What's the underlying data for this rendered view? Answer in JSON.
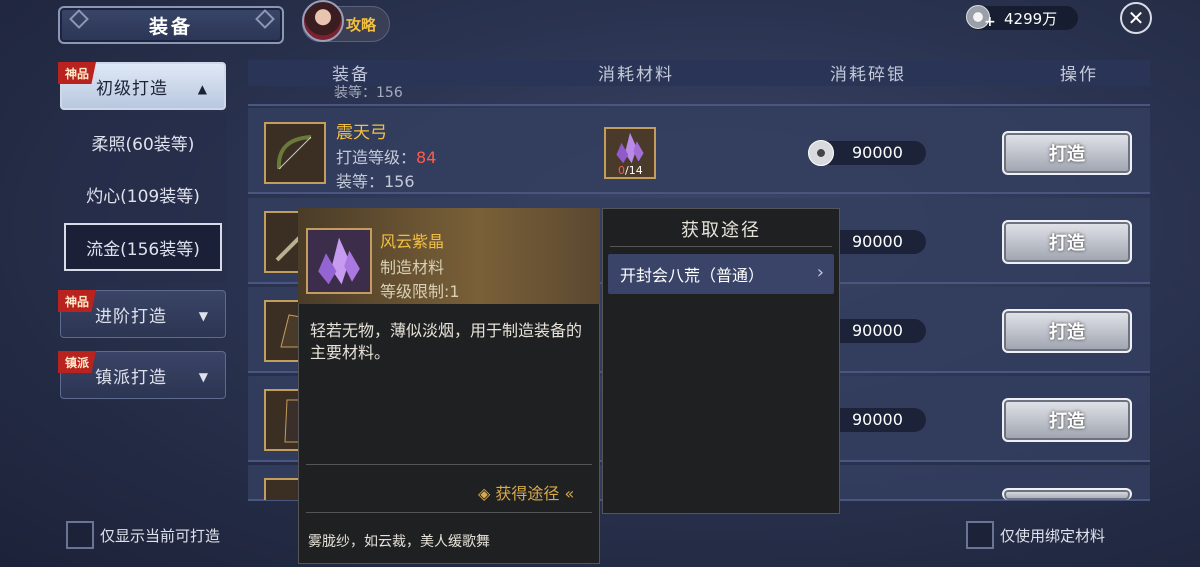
{
  "header": {
    "title": "装备",
    "guide_label": "攻略",
    "currency": "4299万",
    "close_icon": "close-icon"
  },
  "menu": {
    "primary": {
      "tag": "神品",
      "label": "初级打造",
      "expanded": true
    },
    "sub_items": [
      "柔照(60装等)",
      "灼心(109装等)",
      "流金(156装等)"
    ],
    "selected_sub": "流金(156装等)",
    "advanced": {
      "tag": "神品",
      "label": "进阶打造"
    },
    "sect": {
      "tag": "镇派",
      "label": "镇派打造"
    }
  },
  "table": {
    "headers": [
      "装备",
      "消耗材料",
      "消耗碎银",
      "操作"
    ],
    "partial_top_text": "装等：156",
    "rows": [
      {
        "name": "震天弓",
        "craft_level_label": "打造等级：",
        "craft_level": "84",
        "equip_level": "装等：156",
        "material_count": "0",
        "material_need": "/14",
        "cost": "90000",
        "action": "打造"
      },
      {
        "cost": "90000",
        "action": "打造"
      },
      {
        "cost": "90000",
        "action": "打造"
      },
      {
        "cost": "90000",
        "action": "打造"
      }
    ]
  },
  "tooltip": {
    "name": "风云紫晶",
    "type": "制造材料",
    "level_limit": "等级限制:1",
    "description": "轻若无物，薄似淡烟，用于制造装备的主要材料。",
    "source_link": "获得途径",
    "flavor": "雾胧纱，如云裁，美人缓歌舞"
  },
  "source_panel": {
    "title": "获取途径",
    "items": [
      "开封会八荒（普通）"
    ]
  },
  "footer": {
    "left_checkbox": "仅显示当前可打造",
    "right_checkbox": "仅使用绑定材料"
  },
  "colors": {
    "accent_gold": "#f2c040",
    "tag_red": "#b8231f",
    "level_red": "#ff5a4a"
  }
}
